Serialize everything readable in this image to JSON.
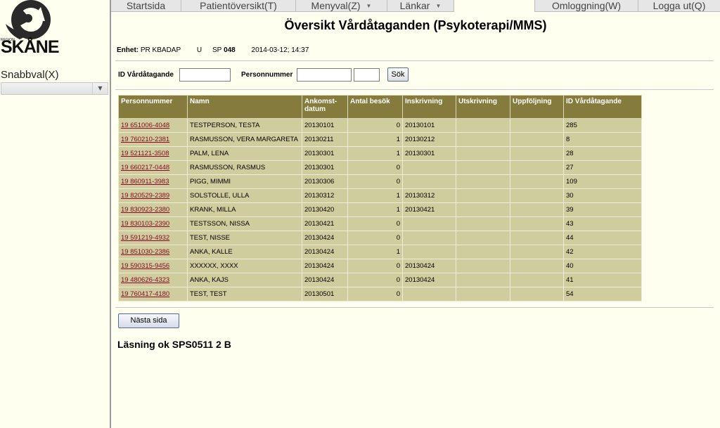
{
  "sidebar": {
    "logo_region": "REGION",
    "logo_text": "SKÅNE",
    "snabbval_label": "Snabbval(X)",
    "snabbval_value": ""
  },
  "nav": {
    "items": [
      {
        "label": "Startsida"
      },
      {
        "label": "Patientöversikt(T)"
      },
      {
        "label": "Menyval(Z)"
      },
      {
        "label": "Länkar"
      },
      {
        "label": "Omloggning(W)"
      },
      {
        "label": "Logga ut(Q)"
      }
    ]
  },
  "page": {
    "title": "Översikt Vårdåtaganden (Psykoterapi/MMS)",
    "enhet_label": "Enhet:",
    "enhet_value": "PR KBADAP",
    "u": "U",
    "sp_label": "SP",
    "sp_value": "048",
    "datetime": "2014-03-12; 14:37"
  },
  "search": {
    "id_label": "ID Vårdåtagande",
    "id_value": "",
    "pnr_label": "Personnummer",
    "pnr_value": "",
    "pnr_value2": "",
    "button": "Sök"
  },
  "table": {
    "headers": [
      "Personnummer",
      "Namn",
      "Ankomst-datum",
      "Antal besök",
      "Inskrivning",
      "Utskrivning",
      "Uppföljning",
      "ID Vårdåtagande"
    ],
    "rows": [
      [
        "19 651006-4048",
        "TESTPERSON, TESTA",
        "20130101",
        "0",
        "20130101",
        "",
        "",
        "285"
      ],
      [
        "19 760210-2381",
        "RASMUSSON, VERA MARGARETA",
        "20130211",
        "1",
        "20130212",
        "",
        "",
        "8"
      ],
      [
        "19 521121-3508",
        "PALM, LENA",
        "20130301",
        "1",
        "20130301",
        "",
        "",
        "28"
      ],
      [
        "19 660217-0448",
        "RASMUSSON, RASMUS",
        "20130301",
        "0",
        "",
        "",
        "",
        "27"
      ],
      [
        "19 860911-3983",
        "PIGG, MIMMI",
        "20130306",
        "0",
        "",
        "",
        "",
        "109"
      ],
      [
        "19 820529-2389",
        "SOLSTOLLE, ULLA",
        "20130312",
        "1",
        "20130312",
        "",
        "",
        "30"
      ],
      [
        "19 830923-2380",
        "KRANK, MILLA",
        "20130420",
        "1",
        "20130421",
        "",
        "",
        "39"
      ],
      [
        "19 830103-2390",
        "TESTSSON, NISSA",
        "20130421",
        "0",
        "",
        "",
        "",
        "43"
      ],
      [
        "19 591219-4932",
        "TEST, NISSE",
        "20130424",
        "0",
        "",
        "",
        "",
        "44"
      ],
      [
        "19 851030-2386",
        "ANKA, KALLE",
        "20130424",
        "1",
        "",
        "",
        "",
        "42"
      ],
      [
        "19 590315-9456",
        "XXXXXX, XXXX",
        "20130424",
        "0",
        "20130424",
        "",
        "",
        "40"
      ],
      [
        "19 480626-4323",
        "ANKA, KAJS",
        "20130424",
        "0",
        "20130424",
        "",
        "",
        "41"
      ],
      [
        "19 760417-4180",
        "TEST, TEST",
        "20130501",
        "0",
        "",
        "",
        "",
        "54"
      ]
    ]
  },
  "next_button": "Nästa sida",
  "status": "Läsning ok SPS0511 2 B",
  "colors": {
    "header_bg": "#857b3c",
    "row_bg": "#cfcc9d",
    "link": "#8a0a2a",
    "page_bg": "#fffff0"
  }
}
